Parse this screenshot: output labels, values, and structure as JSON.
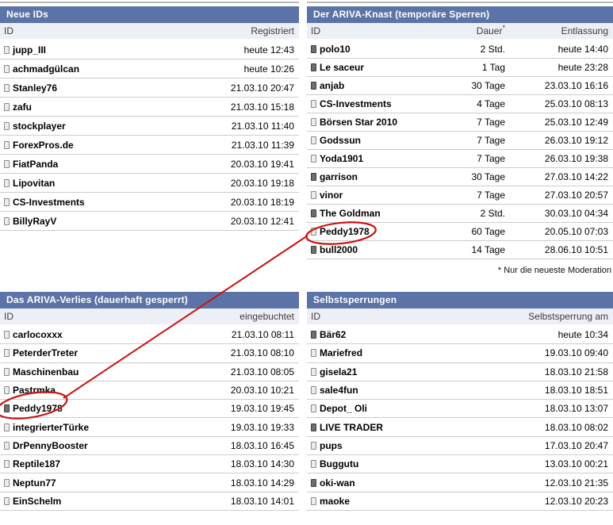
{
  "colors": {
    "title_bar_bg": "#5b73a7",
    "title_text": "#ffffff",
    "column_header_bg": "#edeff7",
    "row_border": "#cccccc",
    "annotation_red": "#cc1111"
  },
  "panels": {
    "neue_ids": {
      "title": "Neue IDs",
      "col_id": "ID",
      "col_value": "Registriert",
      "rows": [
        {
          "id": "jupp_III",
          "value": "heute 12:43",
          "icon": "user-light"
        },
        {
          "id": "achmadgülcan",
          "value": "heute 10:26",
          "icon": "user-light"
        },
        {
          "id": "Stanley76",
          "value": "21.03.10 20:47",
          "icon": "user-light"
        },
        {
          "id": "zafu",
          "value": "21.03.10 15:18",
          "icon": "user-light"
        },
        {
          "id": "stockplayer",
          "value": "21.03.10 11:40",
          "icon": "user-light"
        },
        {
          "id": "ForexPros.de",
          "value": "21.03.10 11:39",
          "icon": "user-light"
        },
        {
          "id": "FiatPanda",
          "value": "20.03.10 19:41",
          "icon": "user-light"
        },
        {
          "id": "Lipovitan",
          "value": "20.03.10 19:18",
          "icon": "user-light"
        },
        {
          "id": "CS-Investments",
          "value": "20.03.10 18:19",
          "icon": "user-light"
        },
        {
          "id": "BillyRayV",
          "value": "20.03.10 12:41",
          "icon": "user-light"
        }
      ]
    },
    "knast": {
      "title": "Der ARIVA-Knast (temporäre Sperren)",
      "col_id": "ID",
      "col_dauer": "Dauer",
      "col_dauer_note_marker": "*",
      "col_entlassung": "Entlassung",
      "footnote": "* Nur die neueste Moderation",
      "rows": [
        {
          "id": "polo10",
          "dauer": "2 Std.",
          "entlassung": "heute 14:40",
          "icon": "user-dark"
        },
        {
          "id": "Le saceur",
          "dauer": "1 Tag",
          "entlassung": "heute 23:28",
          "icon": "user-dark"
        },
        {
          "id": "anjab",
          "dauer": "30 Tage",
          "entlassung": "23.03.10 16:16",
          "icon": "user-dark"
        },
        {
          "id": "CS-Investments",
          "dauer": "4 Tage",
          "entlassung": "25.03.10 08:13",
          "icon": "user-light"
        },
        {
          "id": "Börsen Star 2010",
          "dauer": "7 Tage",
          "entlassung": "25.03.10 12:49",
          "icon": "user-light"
        },
        {
          "id": "Godssun",
          "dauer": "7 Tage",
          "entlassung": "26.03.10 19:12",
          "icon": "user-light"
        },
        {
          "id": "Yoda1901",
          "dauer": "7 Tage",
          "entlassung": "26.03.10 19:38",
          "icon": "user-light"
        },
        {
          "id": "garrison",
          "dauer": "30 Tage",
          "entlassung": "27.03.10 14:22",
          "icon": "user-dark"
        },
        {
          "id": "vinor",
          "dauer": "7 Tage",
          "entlassung": "27.03.10 20:57",
          "icon": "user-light"
        },
        {
          "id": "The Goldman",
          "dauer": "2 Std.",
          "entlassung": "30.03.10 04:34",
          "icon": "user-dark"
        },
        {
          "id": "Peddy1978",
          "dauer": "60 Tage",
          "entlassung": "20.05.10 07:03",
          "icon": "user-light"
        },
        {
          "id": "bull2000",
          "dauer": "14 Tage",
          "entlassung": "28.06.10 10:51",
          "icon": "user-dark"
        }
      ]
    },
    "verlies": {
      "title": "Das ARIVA-Verlies (dauerhaft gesperrt)",
      "col_id": "ID",
      "col_value": "eingebuchtet",
      "rows": [
        {
          "id": "carlocoxxx",
          "value": "21.03.10 08:11",
          "icon": "user-light"
        },
        {
          "id": "PeterderTreter",
          "value": "21.03.10 08:10",
          "icon": "user-light"
        },
        {
          "id": "Maschinenbau",
          "value": "21.03.10 08:05",
          "icon": "user-light"
        },
        {
          "id": "Pastrmka",
          "value": "20.03.10 10:21",
          "icon": "user-light"
        },
        {
          "id": "Peddy1978",
          "value": "19.03.10 19:45",
          "icon": "user-dark"
        },
        {
          "id": "integrierterTürke",
          "value": "19.03.10 19:33",
          "icon": "user-light"
        },
        {
          "id": "DrPennyBooster",
          "value": "18.03.10 16:45",
          "icon": "user-light"
        },
        {
          "id": "Reptile187",
          "value": "18.03.10 14:30",
          "icon": "user-light"
        },
        {
          "id": "Neptun77",
          "value": "18.03.10 14:29",
          "icon": "user-light"
        },
        {
          "id": "EinSchelm",
          "value": "18.03.10 14:01",
          "icon": "user-light"
        }
      ]
    },
    "selbst": {
      "title": "Selbstsperrungen",
      "col_id": "ID",
      "col_value": "Selbstsperrung am",
      "rows": [
        {
          "id": "Bär62",
          "value": "heute 10:34",
          "icon": "user-dark"
        },
        {
          "id": "Mariefred",
          "value": "19.03.10 09:40",
          "icon": "user-light"
        },
        {
          "id": "gisela21",
          "value": "18.03.10 21:58",
          "icon": "user-light"
        },
        {
          "id": "sale4fun",
          "value": "18.03.10 18:51",
          "icon": "user-light"
        },
        {
          "id": "Depot_ Oli",
          "value": "18.03.10 13:07",
          "icon": "user-light"
        },
        {
          "id": "LIVE TRADER",
          "value": "18.03.10 08:02",
          "icon": "user-dark"
        },
        {
          "id": "pups",
          "value": "17.03.10 20:47",
          "icon": "user-light"
        },
        {
          "id": "Buggutu",
          "value": "13.03.10 00:21",
          "icon": "user-light"
        },
        {
          "id": "oki-wan",
          "value": "12.03.10 21:35",
          "icon": "user-dark"
        },
        {
          "id": "maoke",
          "value": "12.03.10 20:23",
          "icon": "user-light"
        }
      ]
    }
  },
  "annotation": {
    "highlighted_id": "Peddy1978",
    "color": "#cc1111"
  }
}
